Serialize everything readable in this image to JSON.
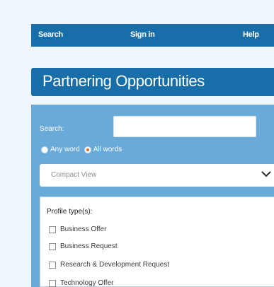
{
  "nav": {
    "links": [
      {
        "label": "Search"
      },
      {
        "label": "Sign in"
      },
      {
        "label": "Help"
      }
    ]
  },
  "header": {
    "title": "Partnering Opportunities"
  },
  "search": {
    "label": "Search:",
    "value": "",
    "placeholder": ""
  },
  "match_mode": {
    "options": [
      {
        "label": "Any word",
        "selected": false
      },
      {
        "label": "All words",
        "selected": true
      }
    ]
  },
  "view": {
    "selected": "Compact View"
  },
  "filters": {
    "profile_type_title": "Profile type(s):",
    "profile_types": [
      {
        "label": "Business Offer",
        "checked": false
      },
      {
        "label": "Business Request",
        "checked": false
      },
      {
        "label": "Research & Development Request",
        "checked": false
      },
      {
        "label": "Technology Offer",
        "checked": false
      }
    ]
  },
  "colors": {
    "brand_blue": "#176ea8",
    "panel_blue": "#6aaad8",
    "radio_accent": "#e06a28"
  }
}
